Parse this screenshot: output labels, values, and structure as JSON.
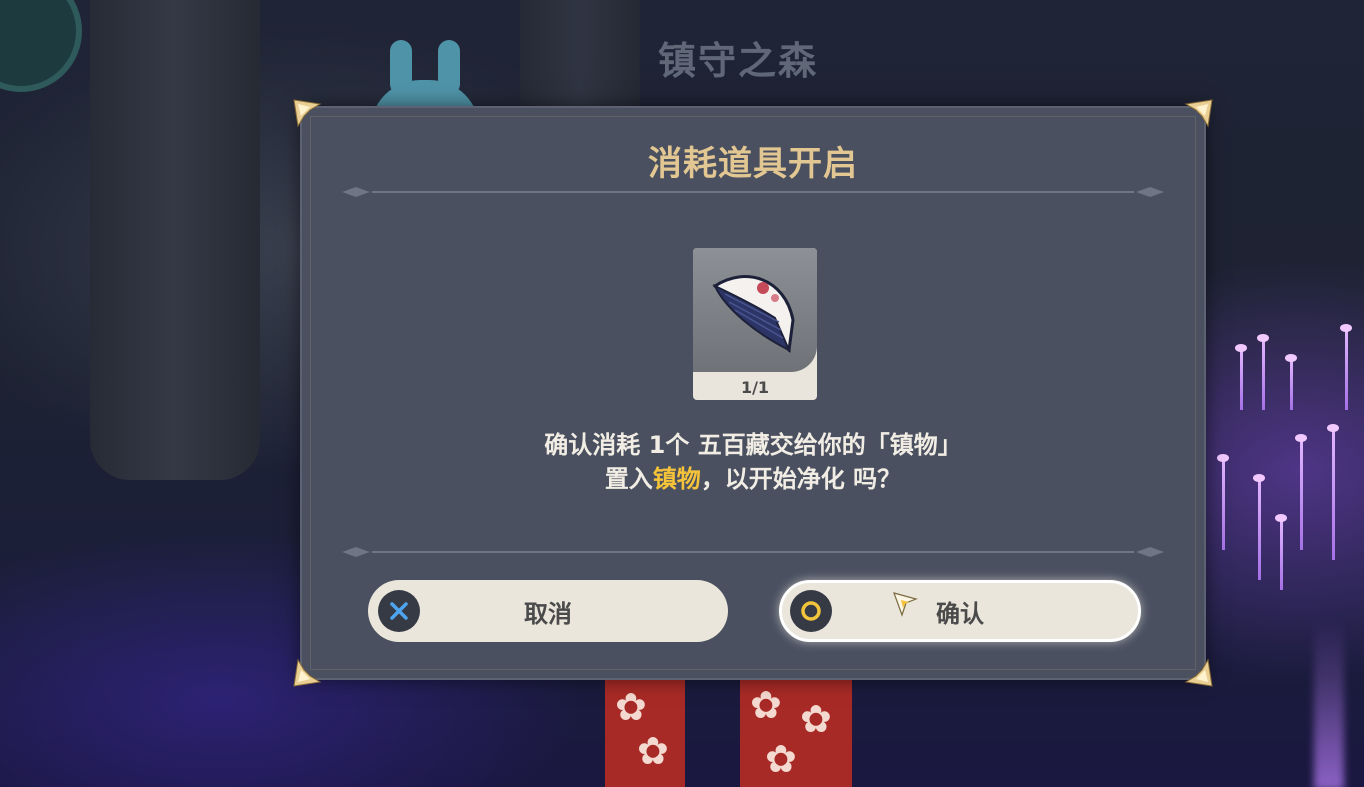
{
  "scene": {
    "location_title": "镇守之森"
  },
  "dialog": {
    "title": "消耗道具开启",
    "item": {
      "icon": "comb-icon",
      "count_text": "1/1"
    },
    "message": {
      "line1": "确认消耗 1个 五百藏交给你的「镇物」",
      "line2_prefix": "置入",
      "line2_highlight": "镇物",
      "line2_suffix": "，以开始净化 吗？"
    },
    "cancel_button": {
      "label": "取消",
      "icon": "cross-icon"
    },
    "confirm_button": {
      "label": "确认",
      "icon": "circle-icon"
    }
  },
  "colors": {
    "title_gold": "#e3c792",
    "highlight_yellow": "#f5c33a",
    "dialog_bg": "#4a5060",
    "button_bg": "#ebe6dc",
    "cross_blue": "#4ea4ee",
    "circle_yellow": "#f2c53c"
  }
}
